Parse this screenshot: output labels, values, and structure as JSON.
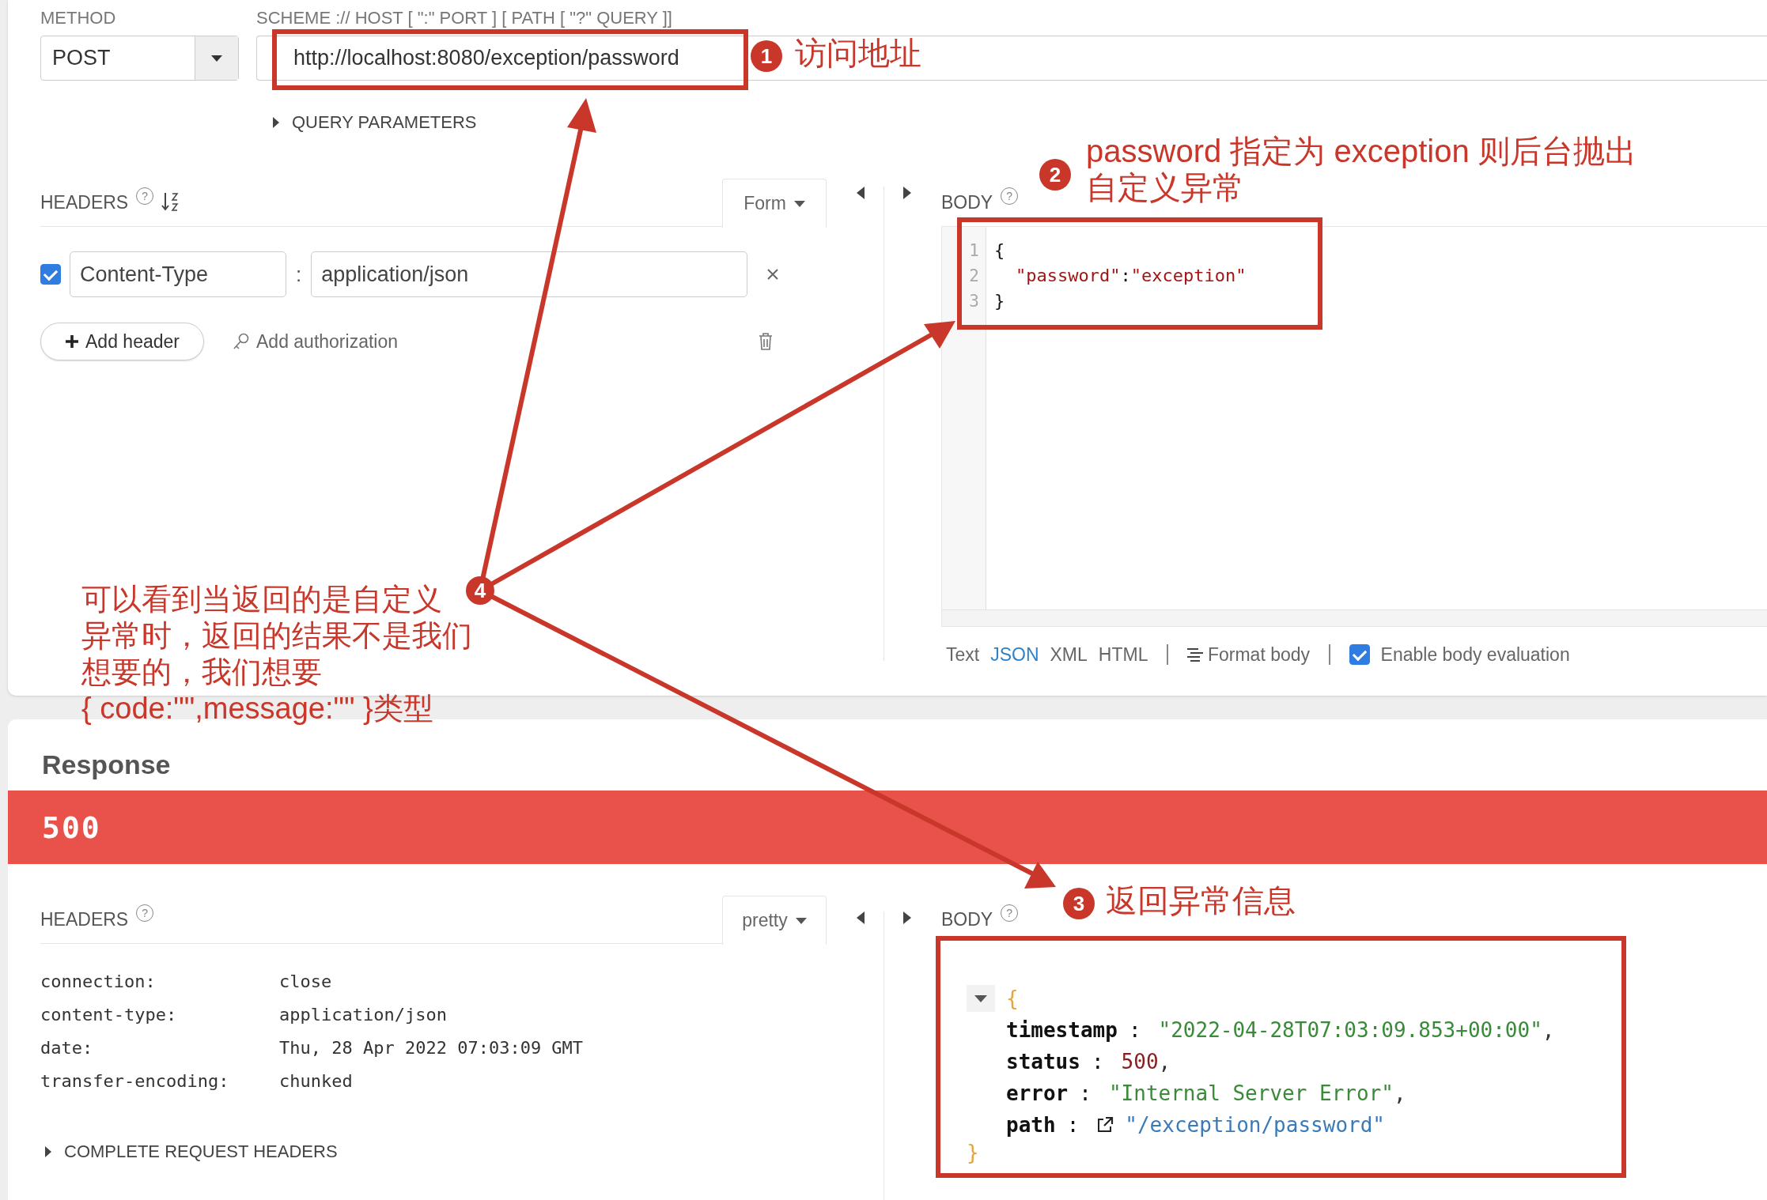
{
  "request": {
    "method_label": "METHOD",
    "method": "POST",
    "url_label": "SCHEME :// HOST [ \":\" PORT ] [ PATH [ \"?\" QUERY ]]",
    "url": "http://localhost:8080/exception/password",
    "query_toggle": "QUERY PARAMETERS",
    "headers_title": "HEADERS",
    "headers_help": "?",
    "body_help": "?",
    "headers_mode": "Form",
    "headers": [
      {
        "checked": true,
        "name": "Content-Type",
        "separator": ":",
        "value": "application/json"
      }
    ],
    "add_header": "Add header",
    "add_authorization": "Add authorization",
    "body_title": "BODY",
    "body_lines": [
      {
        "number": "1",
        "tokens": [
          {
            "kind": "punct",
            "text": "{"
          }
        ]
      },
      {
        "number": "2",
        "indented": true,
        "tokens": [
          {
            "kind": "string",
            "text": "\"password\""
          },
          {
            "kind": "punct",
            "text": ":"
          },
          {
            "kind": "string",
            "text": "\"exception\""
          }
        ]
      },
      {
        "number": "3",
        "tokens": [
          {
            "kind": "punct",
            "text": "}"
          }
        ]
      }
    ],
    "body_formats": [
      {
        "label": "Text",
        "selected": false
      },
      {
        "label": "JSON",
        "selected": true
      },
      {
        "label": "XML",
        "selected": false
      },
      {
        "label": "HTML",
        "selected": false
      }
    ],
    "format_body": "Format body",
    "body_evaluation": {
      "label": "Enable body evaluation",
      "checked": true
    }
  },
  "response": {
    "title": "Response",
    "status": "500",
    "headers_title": "HEADERS",
    "headers_help": "?",
    "body_help": "?",
    "headers_mode": "pretty",
    "headers": [
      {
        "name": "connection:",
        "value": "close"
      },
      {
        "name": "content-type:",
        "value": "application/json"
      },
      {
        "name": "date:",
        "value": "Thu, 28 Apr 2022 07:03:09 GMT"
      },
      {
        "name": "transfer-encoding:",
        "value": "chunked"
      }
    ],
    "complete_headers": "COMPLETE REQUEST HEADERS",
    "body_title": "BODY",
    "open": "{",
    "close": "}",
    "body_fields": [
      {
        "key": "timestamp",
        "colon": ":",
        "value": "\"2022-04-28T07:03:09.853+00:00\"",
        "separator": ",",
        "kind": "string"
      },
      {
        "key": "status",
        "colon": ":",
        "value": "500",
        "separator": ",",
        "kind": "number"
      },
      {
        "key": "error",
        "colon": ":",
        "value": "\"Internal Server Error\"",
        "separator": ",",
        "kind": "string"
      },
      {
        "key": "path",
        "colon": ":",
        "value": "\"/exception/password\"",
        "kind": "link"
      }
    ]
  },
  "annotations": [
    {
      "number": "1",
      "lines": [
        "访问地址"
      ]
    },
    {
      "number": "2",
      "lines": [
        "password 指定为 exception 则后台抛出",
        "自定义异常"
      ]
    },
    {
      "number": "3",
      "lines": [
        "返回异常信息"
      ]
    },
    {
      "number": "4",
      "lines": [
        "可以看到当返回的是自定义",
        "异常时，返回的结果不是我们",
        "想要的，我们想要",
        "{ code:\"\",message:\"\" }类型"
      ]
    }
  ]
}
